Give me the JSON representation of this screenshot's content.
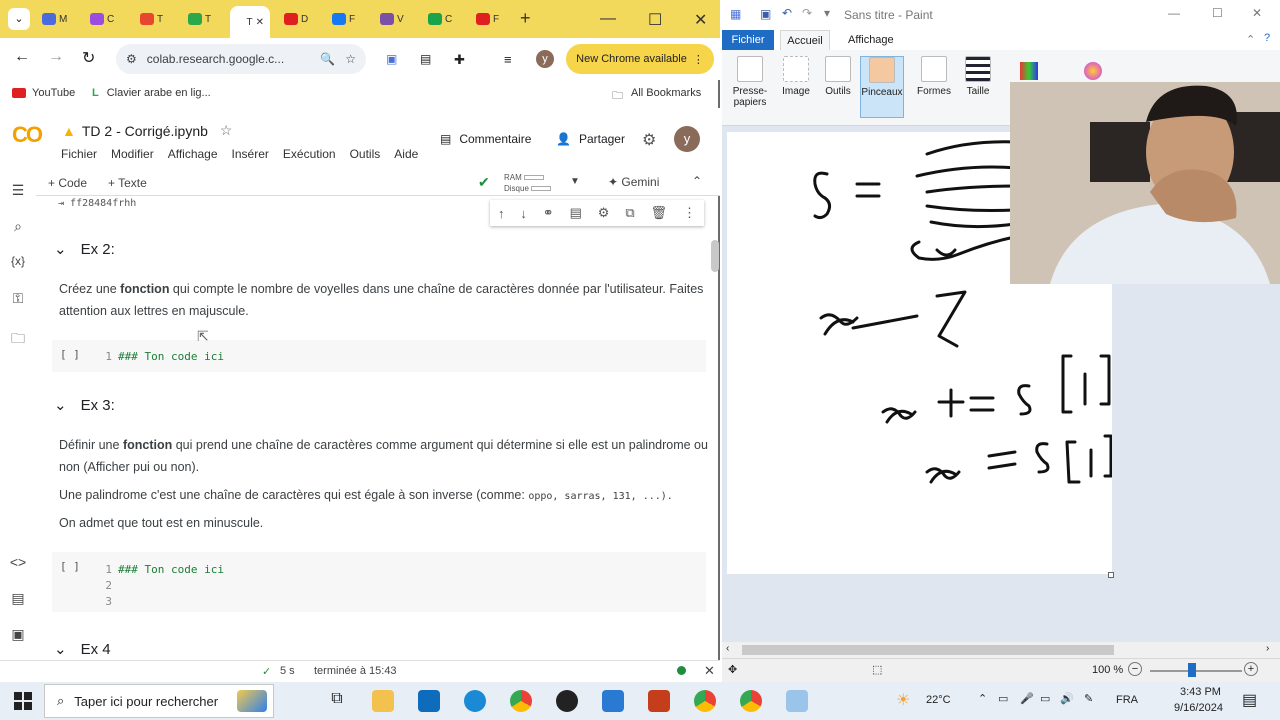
{
  "chrome": {
    "tabs": [
      {
        "label": "M",
        "color": "#4b6bdc"
      },
      {
        "label": "C",
        "color": "#9b4de0"
      },
      {
        "label": "T",
        "color": "#e8472f"
      },
      {
        "label": "T",
        "color": "#2aa84a"
      },
      {
        "label": "T",
        "color": "#ffffff"
      },
      {
        "label": "D",
        "color": "#e02020"
      },
      {
        "label": "F",
        "color": "#1877f2"
      },
      {
        "label": "V",
        "color": "#7b4fa8"
      },
      {
        "label": "C",
        "color": "#19a34a"
      },
      {
        "label": "F",
        "color": "#e02020"
      }
    ],
    "active_tab_label": "T",
    "url": "colab.research.google.c...",
    "new_chrome_label": "New Chrome available",
    "profile_initial": "y",
    "bookmarks": [
      {
        "label": "YouTube"
      },
      {
        "label": "Clavier arabe en lig..."
      }
    ],
    "all_bookmarks": "All Bookmarks"
  },
  "colab": {
    "logo": "CO",
    "notebook_title": "TD 2 - Corrigé.ipynb",
    "menu": [
      "Fichier",
      "Modifier",
      "Affichage",
      "Insérer",
      "Exécution",
      "Outils",
      "Aide"
    ],
    "comment_label": "Commentaire",
    "share_label": "Partager",
    "add_code": "+ Code",
    "add_text": "+ Texte",
    "ram_label": "RAM",
    "disk_label": "Disque",
    "gemini_label": "Gemini",
    "prev_output": "ff28484frhh",
    "sections": [
      {
        "title": "Ex 2:",
        "paragraphs": [
          {
            "pre": "Créez une ",
            "bold": "fonction",
            "post": " qui compte le nombre de voyelles dans une chaîne de caractères donnée par l'utilisateur. Faites attention aux lettres en majuscule."
          }
        ],
        "code": [
          "### Ton code ici"
        ]
      },
      {
        "title": "Ex 3:",
        "paragraphs": [
          {
            "pre": "Définir une ",
            "bold": "fonction",
            "post": " qui prend une chaîne de caractères comme argument qui détermine si elle est un palindrome ou non (Afficher pui ou non)."
          },
          {
            "pre": "Une palindrome c'est une chaîne de caractères qui est égale à son inverse (comme: ",
            "bold": "",
            "post": "oppo, sarras, 131, ...)."
          },
          {
            "pre": "On admet que tout est en minuscule.",
            "bold": "",
            "post": ""
          }
        ],
        "code": [
          "### Ton code ici",
          "",
          ""
        ]
      },
      {
        "title": "Ex 4",
        "paragraphs": [],
        "code": []
      }
    ],
    "cell_bracket": "[ ]",
    "status_time": "5 s",
    "status_done": "terminée à 15:43"
  },
  "paint": {
    "title": "Sans titre - Paint",
    "file_tab": "Fichier",
    "tabs": [
      "Accueil",
      "Affichage"
    ],
    "groups": [
      "Presse-papiers",
      "Image",
      "Outils",
      "Pinceaux",
      "Formes",
      "Taille"
    ],
    "zoom": "100 %"
  },
  "taskbar": {
    "search_placeholder": "Taper ici pour rechercher",
    "temperature": "22°C",
    "language": "FRA",
    "time": "3:43 PM",
    "date": "9/16/2024"
  }
}
